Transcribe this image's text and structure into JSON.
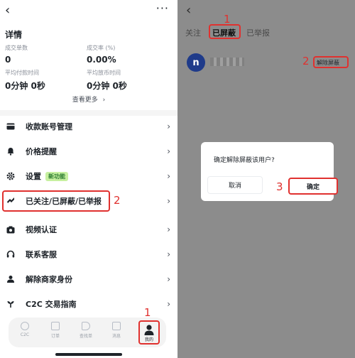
{
  "left": {
    "back_icon": "chevron-left-icon",
    "more_icon": "more-dots-icon",
    "more_glyph": "···",
    "back_glyph": "‹",
    "section_title": "详情",
    "stats": [
      {
        "label": "成交单数",
        "value": "0"
      },
      {
        "label": "成交率 (%)",
        "value": "0.00%"
      },
      {
        "label": "平均付款时间",
        "value": "0分钟 0秒"
      },
      {
        "label": "平均放币时间",
        "value": "0分钟 0秒"
      }
    ],
    "see_more": "查看更多",
    "see_more_glyph": "›",
    "chevron_glyph": "›",
    "menu": [
      {
        "label": "收款账号管理",
        "icon": "card-icon"
      },
      {
        "label": "价格提醒",
        "icon": "bell-icon"
      },
      {
        "label": "设置",
        "icon": "gear-icon",
        "badge": "新功能"
      },
      {
        "label": "已关注/已屏蔽/已举报",
        "icon": "follow-block-icon"
      },
      {
        "label": "视频认证",
        "icon": "camera-icon"
      },
      {
        "label": "联系客服",
        "icon": "headset-icon"
      },
      {
        "label": "解除商家身份",
        "icon": "merchant-icon"
      },
      {
        "label": "C2C 交易指南",
        "icon": "guide-icon"
      }
    ],
    "annotations": {
      "menu_step": "2",
      "nav_step": "1"
    },
    "bottom_nav": [
      {
        "label": "C2C",
        "icon": "c2c-icon"
      },
      {
        "label": "订单",
        "icon": "orders-icon"
      },
      {
        "label": "查找单",
        "icon": "megaphone-icon"
      },
      {
        "label": "消息",
        "icon": "message-icon"
      },
      {
        "label": "我的",
        "icon": "person-icon"
      }
    ]
  },
  "right": {
    "back_glyph": "‹",
    "tabs": [
      {
        "label": "关注"
      },
      {
        "label": "已屏蔽"
      },
      {
        "label": "已举报"
      }
    ],
    "avatar_letter": "n",
    "unblock_label": "解除屏蔽",
    "annotations": {
      "tab_step": "1",
      "unblock_step": "2",
      "confirm_step": "3"
    },
    "dialog": {
      "message": "确定解除屏蔽该用户?",
      "cancel": "取消",
      "confirm": "确定"
    }
  },
  "colors": {
    "annotation_red": "#e0312f",
    "overlay_gray": "#8c8c8c",
    "badge_green": "#c7f0a0"
  }
}
